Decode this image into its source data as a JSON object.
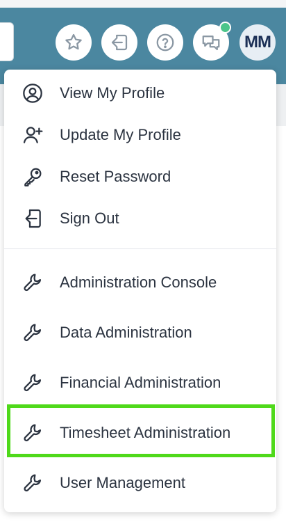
{
  "header": {
    "avatar_initials": "MM",
    "buttons": [
      {
        "icon": "star-icon"
      },
      {
        "icon": "switch-user-icon"
      },
      {
        "icon": "help-icon"
      },
      {
        "icon": "chat-icon"
      }
    ],
    "notification_color": "#4cc58a",
    "brand_color": "#4b87a0"
  },
  "menu": {
    "account_items": [
      {
        "label": "View My Profile",
        "icon": "user-circle-icon"
      },
      {
        "label": "Update My Profile",
        "icon": "user-plus-icon"
      },
      {
        "label": "Reset Password",
        "icon": "key-icon"
      },
      {
        "label": "Sign Out",
        "icon": "sign-out-icon"
      }
    ],
    "admin_items": [
      {
        "label": "Administration Console",
        "icon": "wrench-icon"
      },
      {
        "label": "Data Administration",
        "icon": "wrench-icon"
      },
      {
        "label": "Financial Administration",
        "icon": "wrench-icon"
      },
      {
        "label": "Timesheet Administration",
        "icon": "wrench-icon",
        "highlighted": true
      },
      {
        "label": "User Management",
        "icon": "wrench-icon"
      }
    ],
    "highlight_color": "#4fd91a"
  }
}
